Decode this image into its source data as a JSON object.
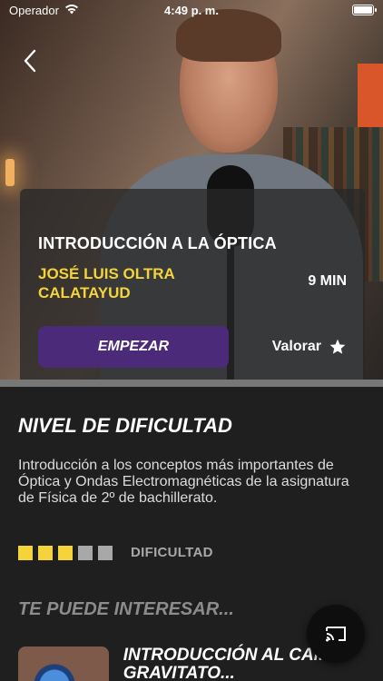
{
  "status_bar": {
    "carrier": "Operador",
    "time": "4:49 p. m."
  },
  "course": {
    "title": "INTRODUCCIÓN A LA ÓPTICA",
    "author": "JOSÉ LUIS OLTRA CALATAYUD",
    "duration": "9 MIN",
    "start_label": "EMPEZAR",
    "rate_label": "Valorar"
  },
  "difficulty": {
    "title": "NIVEL DE DIFICULTAD",
    "description": "Introducción a los conceptos más importantes de Óptica y Ondas Electromagnéticas de la asignatura de Física de 2º de bachillerato.",
    "level": 3,
    "max": 5,
    "label": "DIFICULTAD"
  },
  "related": {
    "section_title": "TE PUEDE INTERESAR...",
    "items": [
      {
        "title": "INTRODUCCIÓN AL CAMPO GRAVITATO..."
      }
    ]
  },
  "icons": {
    "back": "chevron-left-icon",
    "wifi": "wifi-icon",
    "battery": "battery-icon",
    "star": "star-icon",
    "cast": "cast-icon"
  },
  "colors": {
    "accent_yellow": "#f4d43a",
    "button_purple": "#4b2a7a",
    "background": "#1f1f1f"
  }
}
